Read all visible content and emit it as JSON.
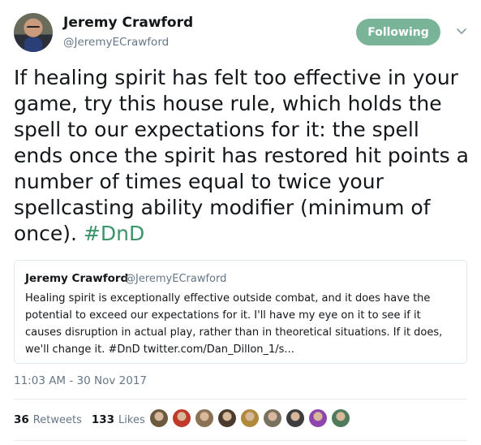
{
  "author": {
    "display_name": "Jeremy Crawford",
    "handle": "@JeremyECrawford"
  },
  "follow_button": {
    "label": "Following"
  },
  "menu_icon": "chevron-down-icon",
  "tweet": {
    "text_before_hashtag": "If healing spirit has felt too effective in your game, try this house rule, which holds the spell to our expectations for it: the spell ends once the spirit has restored hit points a number of times equal to twice your spellcasting ability modifier (minimum of once). ",
    "hashtag": "#DnD"
  },
  "quoted_tweet": {
    "display_name": "Jeremy Crawford",
    "handle": "@JeremyECrawford",
    "text": "Healing spirit is exceptionally effective outside combat, and it does have the potential to exceed our expectations for it. I'll have my eye on it to see if it causes disruption in actual play, rather than in theoretical situations. If it does, we'll change it. #DnD twitter.com/Dan_Dillon_1/s..."
  },
  "timestamp": "11:03 AM - 30 Nov 2017",
  "stats": {
    "retweets_count": "36",
    "retweets_label": "Retweets",
    "likes_count": "133",
    "likes_label": "Likes"
  },
  "colors": {
    "follow_button_bg": "#79b498",
    "hashtag": "#3b946a",
    "secondary_text": "#657786"
  },
  "liker_avatars": [
    {
      "name": "liker-avatar-1",
      "color": "#6b5a3e"
    },
    {
      "name": "liker-avatar-2",
      "color": "#c0392b"
    },
    {
      "name": "liker-avatar-3",
      "color": "#8a7355"
    },
    {
      "name": "liker-avatar-4",
      "color": "#4a3b2e"
    },
    {
      "name": "liker-avatar-5",
      "color": "#b08a3c"
    },
    {
      "name": "liker-avatar-6",
      "color": "#7a7060"
    },
    {
      "name": "liker-avatar-7",
      "color": "#3d3d3d"
    },
    {
      "name": "liker-avatar-8",
      "color": "#8e44ad"
    },
    {
      "name": "liker-avatar-9",
      "color": "#4f7a5c"
    }
  ]
}
